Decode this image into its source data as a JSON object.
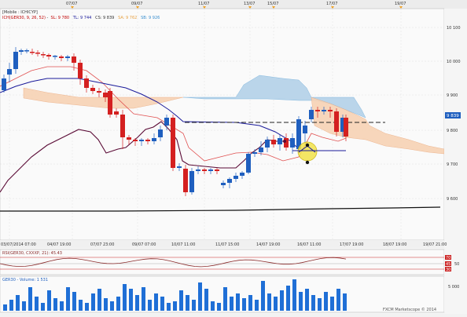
{
  "top_date_labels": [
    "07/07",
    "09/07",
    "11/07",
    "13/07",
    "15/07",
    "17/07",
    "19/07"
  ],
  "chart_header": {
    "line1": "[Mobile : ICHICYP]",
    "line2_parts": [
      {
        "text": "ICH(GER30, 9, 26, 52)",
        "color": "#c00000"
      },
      {
        "text": "SL: 9 780",
        "color": "#c00000"
      },
      {
        "text": "TL: 9 744",
        "color": "#1a1a9a"
      },
      {
        "text": "CS: 9 839",
        "color": "#333333"
      },
      {
        "text": "SA: 9 762",
        "color": "#e6a040"
      },
      {
        "text": "SB: 9 926",
        "color": "#3a8fcf"
      }
    ]
  },
  "price_axis": {
    "labels": [
      "10 100",
      "10 000",
      "9 900",
      "9 800",
      "9 700",
      "9 600"
    ],
    "current_price": "9 839"
  },
  "time_axis_labels": [
    "03/07/2014 07:00",
    "04/07 19:00",
    "07/07 23:00",
    "09/07 07:00",
    "10/07 11:00",
    "11/07 15:00",
    "14/07 19:00",
    "16/07 11:00",
    "17/07 19:00",
    "18/07 19:00",
    "19/07 21:00"
  ],
  "rsi_panel": {
    "title": "RSI(GER30, CXXXP, 21): 45.43",
    "levels": [
      "70",
      "50",
      "30"
    ],
    "current": "45"
  },
  "volume_panel": {
    "title": "GER30 - Volume: 1 531",
    "axis_label": "5 000"
  },
  "footer": {
    "copyright": "FXCM Marketscope © 2014"
  },
  "colors": {
    "bull": "#1f5fbf",
    "bear": "#d42020",
    "chikou": "#5a0a35",
    "tenkan": "#1a1a9a",
    "kijun": "#e05050",
    "cloud_bull": "#b7d4ea",
    "cloud_bear": "#f7d3b5",
    "price_line": "#111111"
  }
}
